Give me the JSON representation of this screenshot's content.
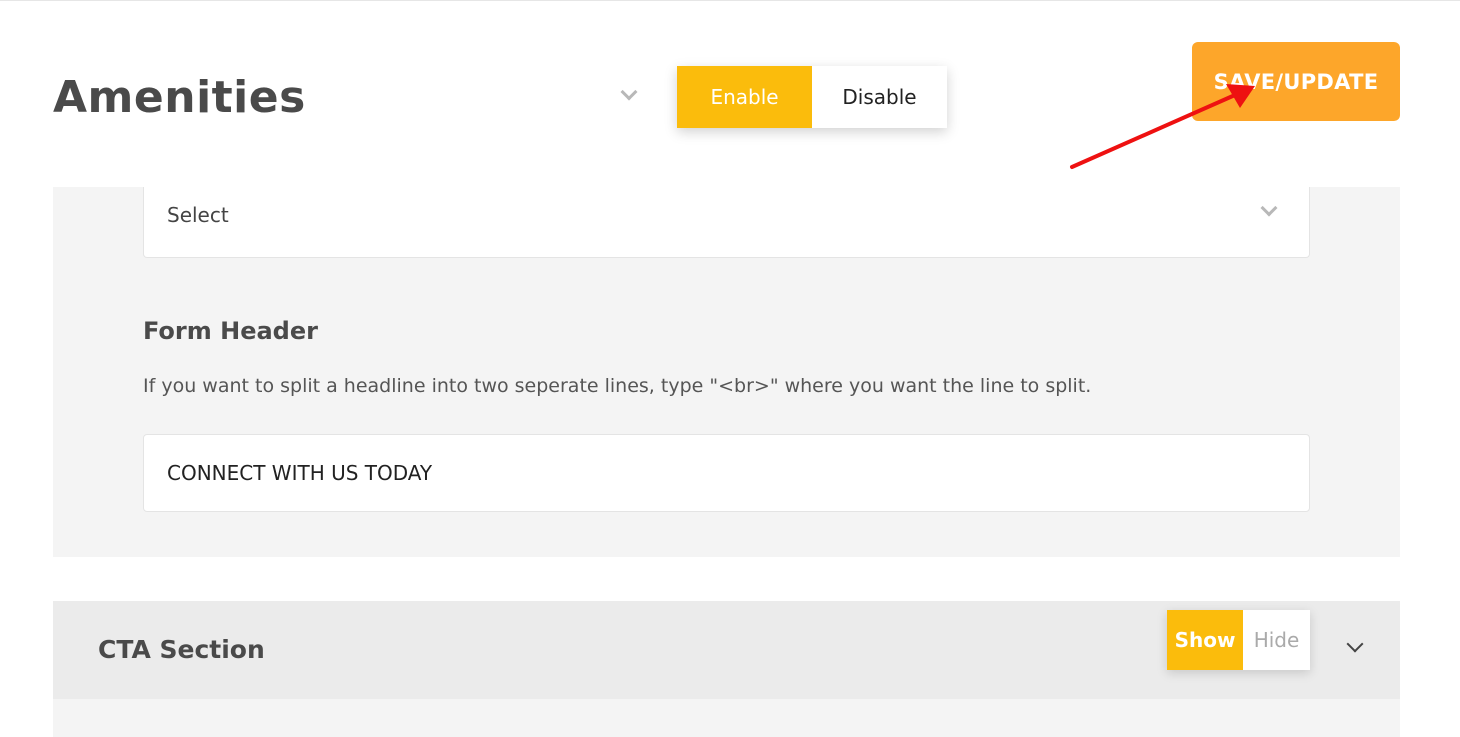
{
  "header": {
    "title": "Amenities",
    "enable_label": "Enable",
    "disable_label": "Disable",
    "save_label": "SAVE/UPDATE"
  },
  "panel": {
    "select_value": "Select",
    "form_header_label": "Form Header",
    "help_text": "If you want to split a headline into two seperate lines, type \"<br>\" where you want the line to split.",
    "form_header_value": "CONNECT WITH US TODAY"
  },
  "cta": {
    "title": "CTA Section",
    "show_label": "Show",
    "hide_label": "Hide"
  },
  "colors": {
    "accent_yellow": "#fbbc0c",
    "save_orange": "#fda62a",
    "annotation_red": "#ee1111"
  },
  "icons": [
    "chevron-down-icon",
    "annotation-arrow"
  ]
}
